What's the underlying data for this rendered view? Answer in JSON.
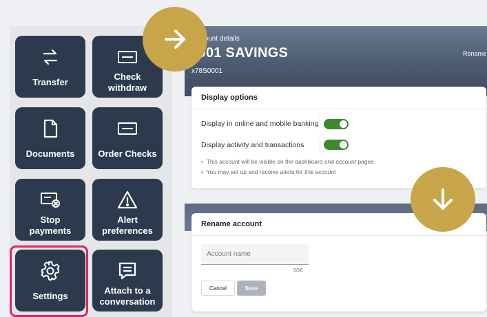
{
  "actions": [
    {
      "label": "Transfer",
      "icon": "transfer-arrows-icon"
    },
    {
      "label": "Check withdraw",
      "icon": "check-icon"
    },
    {
      "label": "Documents",
      "icon": "document-icon"
    },
    {
      "label": "Order Checks",
      "icon": "check-icon"
    },
    {
      "label": "Stop payments",
      "icon": "stop-payment-icon"
    },
    {
      "label": "Alert preferences",
      "icon": "alert-triangle-icon"
    },
    {
      "label": "Settings",
      "icon": "gear-icon"
    },
    {
      "label": "Attach to a conversation",
      "icon": "chat-icon"
    }
  ],
  "header": {
    "subtitle": "Account details",
    "title": "0001 SAVINGS",
    "account_number": "x78S0001",
    "rename_link": "Rename"
  },
  "display_options": {
    "title": "Display options",
    "options": [
      {
        "label": "Display in online and mobile banking",
        "enabled": true
      },
      {
        "label": "Display activity and transactions",
        "enabled": true
      }
    ],
    "notes": [
      "This account will be visible on the dashboard and account pages",
      "You may set up and receive alerts for this account"
    ]
  },
  "rename_account": {
    "title": "Rename account",
    "placeholder": "Account name",
    "counter": "0/16",
    "cancel_label": "Cancel",
    "save_label": "Save"
  },
  "colors": {
    "tile_bg": "#2d3a4e",
    "toggle_on": "#3c8a2e",
    "highlight_ring": "#e0245e",
    "overlay_circle": "#c9a54a"
  },
  "overlays": [
    "arrow-right-icon",
    "arrow-down-icon"
  ]
}
